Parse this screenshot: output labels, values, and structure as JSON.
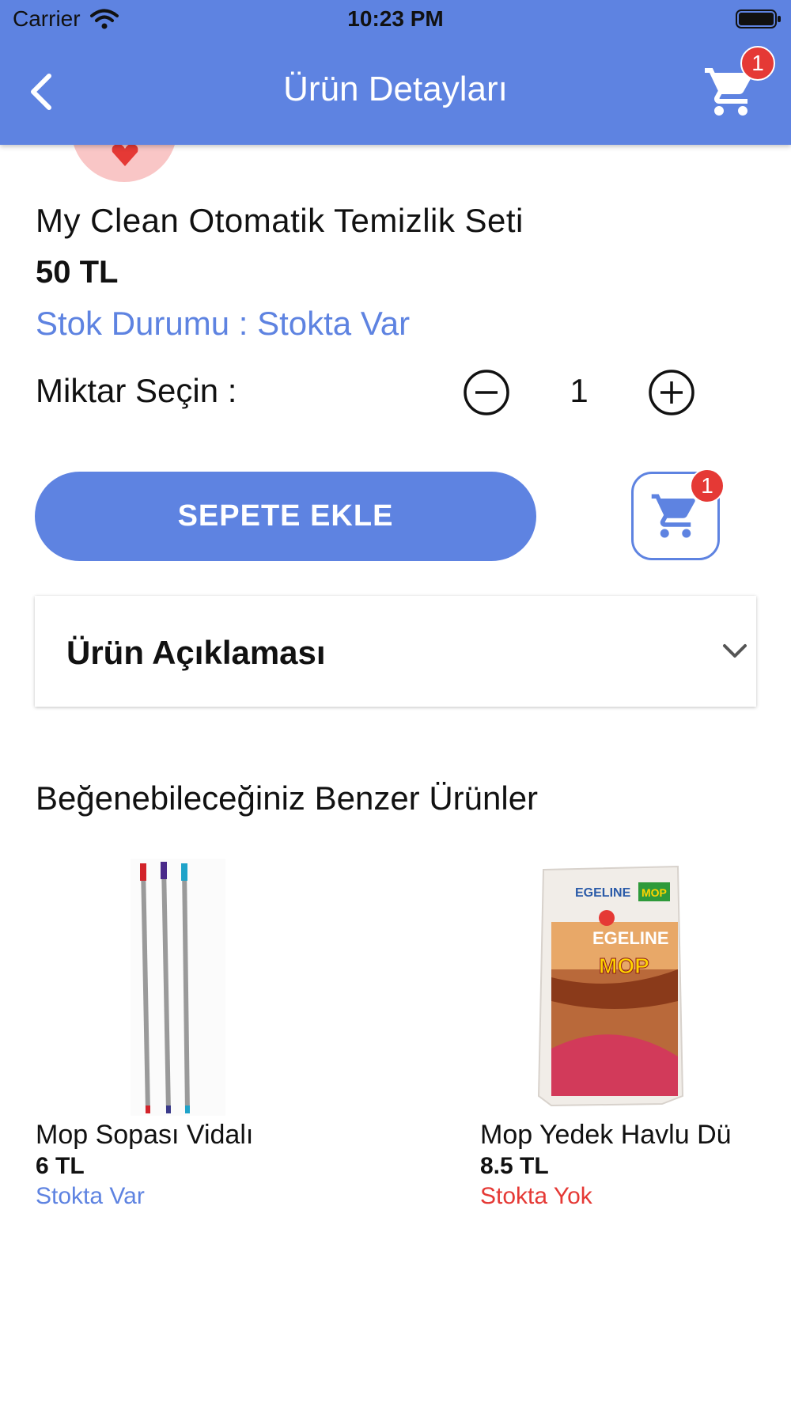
{
  "status_bar": {
    "carrier": "Carrier",
    "time": "10:23 PM"
  },
  "header": {
    "title": "Ürün Detayları",
    "cart_count": "1"
  },
  "product": {
    "name": "My Clean Otomatik Temizlik Seti",
    "price": "50 TL",
    "stock_status": "Stok Durumu : Stokta Var",
    "quantity_label": "Miktar Seçin :",
    "quantity": "1"
  },
  "actions": {
    "add_to_cart_label": "SEPETE EKLE",
    "cart_count": "1"
  },
  "description": {
    "title": "Ürün Açıklaması"
  },
  "similar": {
    "heading": "Beğenebileceğiniz Benzer Ürünler",
    "items": [
      {
        "name": "Mop Sopası Vidalı",
        "price": "6 TL",
        "stock": "Stokta Var",
        "stock_color": "#5e83e1"
      },
      {
        "name": "Mop Yedek Havlu Dü",
        "price": "8.5 TL",
        "stock": "Stokta Yok",
        "stock_color": "#e53935"
      }
    ]
  },
  "colors": {
    "primary": "#5e83e1",
    "badge": "#e53935",
    "favorite_bg": "#f9c6c6"
  },
  "icons": [
    "wifi-icon",
    "battery-icon",
    "back-arrow-icon",
    "cart-icon",
    "heart-icon",
    "minus-circle-icon",
    "plus-circle-icon",
    "chevron-down-icon"
  ]
}
